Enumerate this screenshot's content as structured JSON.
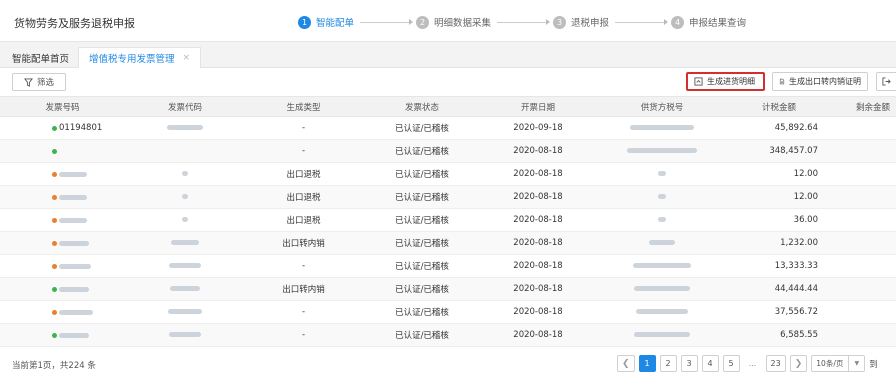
{
  "app": {
    "title": "货物劳务及服务退税申报"
  },
  "steps": [
    {
      "num": "1",
      "label": "智能配单",
      "active": true
    },
    {
      "num": "2",
      "label": "明细数据采集",
      "active": false
    },
    {
      "num": "3",
      "label": "退税申报",
      "active": false
    },
    {
      "num": "4",
      "label": "申报结果查询",
      "active": false
    }
  ],
  "tabs": {
    "home": "智能配单首页",
    "active": "增值税专用发票管理",
    "close": "×"
  },
  "toolbar": {
    "filter": "筛选",
    "entry": "生成进货明细",
    "export": "生成出口转内销证明"
  },
  "icons": {
    "filter": "filter-icon",
    "entry": "document-icon",
    "export": "export-document-icon",
    "more": "exit-icon"
  },
  "colors": {
    "accent": "#1e88e5",
    "highlight": "#d32f2f",
    "green": "#3bb54a",
    "orange": "#f07c2e"
  },
  "table": {
    "headers": [
      "发票号码",
      "发票代码",
      "生成类型",
      "发票状态",
      "开票日期",
      "供货方税号",
      "计税金额",
      "剩余金额"
    ],
    "rows": [
      {
        "dot": "green",
        "number": "01194801",
        "code_blur": true,
        "type": "-",
        "status": "已认证/已稽核",
        "date": "2020-09-18",
        "tax_blur": true,
        "amount": "45,892.64"
      },
      {
        "dot": "green",
        "number": "",
        "code_blur": false,
        "type": "-",
        "status": "已认证/已稽核",
        "date": "2020-08-18",
        "tax_blur": true,
        "amount": "348,457.07"
      },
      {
        "dot": "orange",
        "number": "",
        "code_blur": true,
        "type": "出口退税",
        "status": "已认证/已稽核",
        "date": "2020-08-18",
        "tax_blur": true,
        "amount": "12.00"
      },
      {
        "dot": "orange",
        "number": "",
        "code_blur": true,
        "type": "出口退税",
        "status": "已认证/已稽核",
        "date": "2020-08-18",
        "tax_blur": true,
        "amount": "12.00"
      },
      {
        "dot": "orange",
        "number": "",
        "code_blur": true,
        "type": "出口退税",
        "status": "已认证/已稽核",
        "date": "2020-08-18",
        "tax_blur": true,
        "amount": "36.00"
      },
      {
        "dot": "orange",
        "number": "",
        "code_blur": true,
        "type": "出口转内销",
        "status": "已认证/已稽核",
        "date": "2020-08-18",
        "tax_blur": true,
        "amount": "1,232.00"
      },
      {
        "dot": "orange",
        "number": "",
        "code_blur": true,
        "type": "-",
        "status": "已认证/已稽核",
        "date": "2020-08-18",
        "tax_blur": true,
        "amount": "13,333.33"
      },
      {
        "dot": "green",
        "number": "",
        "code_blur": true,
        "type": "出口转内销",
        "status": "已认证/已稽核",
        "date": "2020-08-18",
        "tax_blur": true,
        "amount": "44,444.44"
      },
      {
        "dot": "orange",
        "number": "",
        "code_blur": true,
        "type": "-",
        "status": "已认证/已稽核",
        "date": "2020-08-18",
        "tax_blur": true,
        "amount": "37,556.72"
      },
      {
        "dot": "green",
        "number": "",
        "code_blur": true,
        "type": "-",
        "status": "已认证/已稽核",
        "date": "2020-08-18",
        "tax_blur": true,
        "amount": "6,585.55"
      }
    ]
  },
  "footer": {
    "summary": "当前第1页，共224 条",
    "pages": [
      "1",
      "2",
      "3",
      "4",
      "5"
    ],
    "ellipsis": "...",
    "last_page": "23",
    "page_size": "10条/页",
    "goto": "到"
  }
}
